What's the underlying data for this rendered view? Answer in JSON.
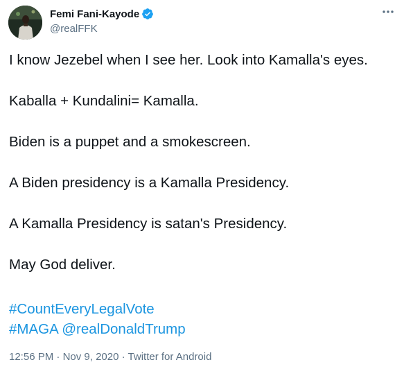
{
  "author": {
    "display_name": "Femi Fani-Kayode",
    "handle": "@realFFK",
    "verified": true
  },
  "icons": {
    "verified": "verified-badge-icon",
    "more": "more-options-icon",
    "avatar": "profile-photo"
  },
  "tweet": {
    "paragraphs": [
      "I know Jezebel when I see her. Look into Kamalla's eyes.",
      "Kaballa + Kundalini= Kamalla.",
      "Biden is a puppet and a smokescreen.",
      "A Biden presidency is a Kamalla Presidency.",
      "A Kamalla Presidency is satan's Presidency.",
      "May God deliver."
    ],
    "hashtag1": "#CountEveryLegalVote",
    "hashtag2": "#MAGA",
    "mention": "@realDonaldTrump"
  },
  "meta": {
    "time": "12:56 PM",
    "separator": "·",
    "date": "Nov 9, 2020",
    "source": "Twitter for Android"
  },
  "colors": {
    "link": "#1b95e0",
    "secondary_text": "#5b7083",
    "verified_badge": "#1da1f2"
  }
}
